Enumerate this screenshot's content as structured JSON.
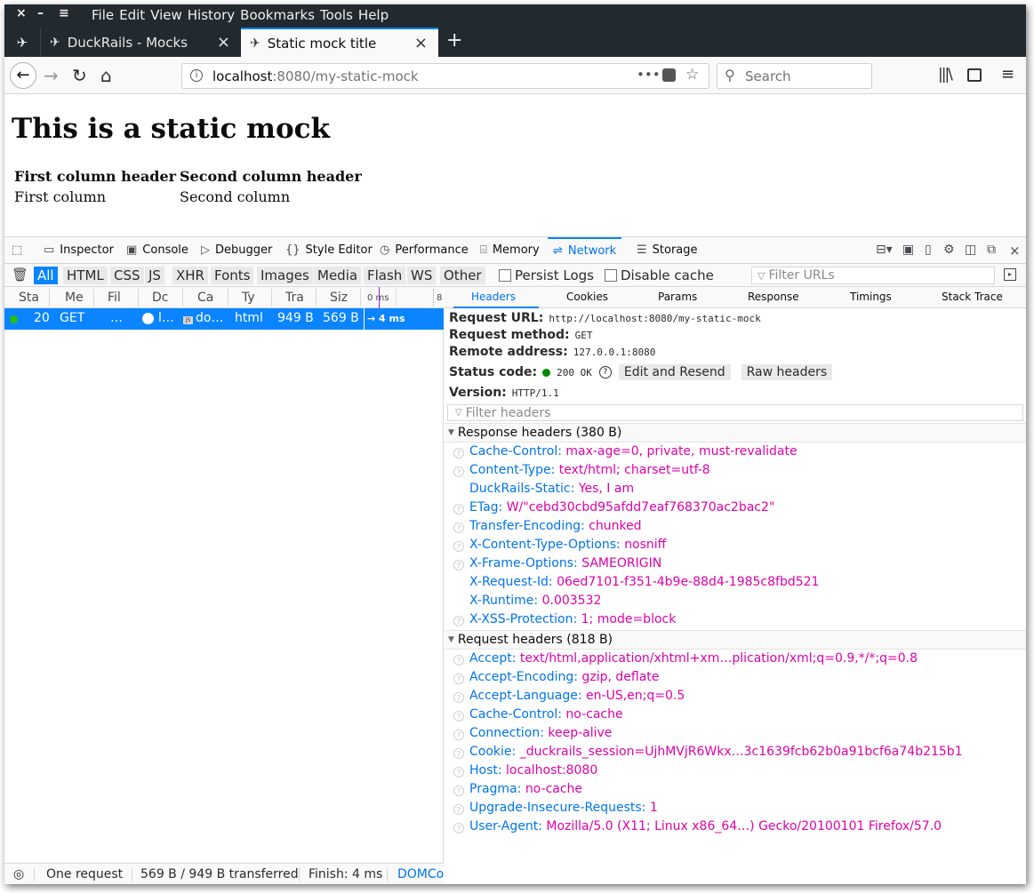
{
  "window": {
    "controls": {
      "close": "×",
      "minimize": "–",
      "menu": "≡"
    },
    "menu": [
      "File",
      "Edit",
      "View",
      "History",
      "Bookmarks",
      "Tools",
      "Help"
    ]
  },
  "tabs": [
    {
      "title": "DuckRails - Mocks",
      "active": false
    },
    {
      "title": "Static mock title",
      "active": true
    }
  ],
  "navbar": {
    "url_host": "localhost",
    "url_rest": ":8080/my-static-mock",
    "search_placeholder": "Search"
  },
  "page": {
    "heading": "This is a static mock",
    "table": {
      "headers": [
        "First column header",
        "Second column header"
      ],
      "row": [
        "First column",
        "Second column"
      ]
    }
  },
  "devtools": {
    "tools": [
      "Inspector",
      "Console",
      "Debugger",
      "Style Editor",
      "Performance",
      "Memory",
      "Network",
      "Storage"
    ],
    "active_tool": "Network",
    "type_filters": [
      "All",
      "HTML",
      "CSS",
      "JS",
      "XHR",
      "Fonts",
      "Images",
      "Media",
      "Flash",
      "WS",
      "Other"
    ],
    "persist_logs": "Persist Logs",
    "disable_cache": "Disable cache",
    "filter_urls_placeholder": "Filter URLs",
    "columns": [
      "Sta",
      "Me",
      "Fil",
      "Dc",
      "Ca",
      "Ty",
      "Tra",
      "Siz",
      "0 ms",
      "8"
    ],
    "request": {
      "status": "20",
      "method": "GET",
      "file": "…",
      "domain": "l…",
      "cause": "do…",
      "type": "html",
      "transferred": "949 B",
      "size": "569 B",
      "timing": "→ 4 ms"
    },
    "detail_tabs": [
      "Headers",
      "Cookies",
      "Params",
      "Response",
      "Timings",
      "Stack Trace"
    ],
    "summary": {
      "request_url_label": "Request URL:",
      "request_url": "http://localhost:8080/my-static-mock",
      "method_label": "Request method:",
      "method": "GET",
      "remote_label": "Remote address:",
      "remote": "127.0.0.1:8080",
      "status_label": "Status code:",
      "status": "200 OK",
      "edit_resend": "Edit and Resend",
      "raw_headers": "Raw headers",
      "version_label": "Version:",
      "version": "HTTP/1.1"
    },
    "filter_headers_placeholder": "Filter headers",
    "response_headers_title": "Response headers (380 B)",
    "response_headers": [
      {
        "k": "Cache-Control:",
        "v": "max-age=0, private, must-revalidate",
        "q": true
      },
      {
        "k": "Content-Type:",
        "v": "text/html; charset=utf-8",
        "q": true
      },
      {
        "k": "DuckRails-Static:",
        "v": "Yes, I am",
        "q": false
      },
      {
        "k": "ETag:",
        "v": "W/\"cebd30cbd95afdd7eaf768370ac2bac2\"",
        "q": true
      },
      {
        "k": "Transfer-Encoding:",
        "v": "chunked",
        "q": true
      },
      {
        "k": "X-Content-Type-Options:",
        "v": "nosniff",
        "q": true
      },
      {
        "k": "X-Frame-Options:",
        "v": "SAMEORIGIN",
        "q": true
      },
      {
        "k": "X-Request-Id:",
        "v": "06ed7101-f351-4b9e-88d4-1985c8fbd521",
        "q": false
      },
      {
        "k": "X-Runtime:",
        "v": "0.003532",
        "q": false
      },
      {
        "k": "X-XSS-Protection:",
        "v": "1; mode=block",
        "q": true
      }
    ],
    "request_headers_title": "Request headers (818 B)",
    "request_headers": [
      {
        "k": "Accept:",
        "v": "text/html,application/xhtml+xm…plication/xml;q=0.9,*/*;q=0.8",
        "q": true
      },
      {
        "k": "Accept-Encoding:",
        "v": "gzip, deflate",
        "q": true
      },
      {
        "k": "Accept-Language:",
        "v": "en-US,en;q=0.5",
        "q": true
      },
      {
        "k": "Cache-Control:",
        "v": "no-cache",
        "q": true
      },
      {
        "k": "Connection:",
        "v": "keep-alive",
        "q": true
      },
      {
        "k": "Cookie:",
        "v": "_duckrails_session=UjhMVjR6Wkx…3c1639fcb62b0a91bcf6a74b215b1",
        "q": true
      },
      {
        "k": "Host:",
        "v": "localhost:8080",
        "q": true
      },
      {
        "k": "Pragma:",
        "v": "no-cache",
        "q": true
      },
      {
        "k": "Upgrade-Insecure-Requests:",
        "v": "1",
        "q": true
      },
      {
        "k": "User-Agent:",
        "v": "Mozilla/5.0 (X11; Linux x86_64…) Gecko/20100101 Firefox/57.0",
        "q": true
      }
    ],
    "statusbar": {
      "requests": "One request",
      "transferred": "569 B / 949 B transferred",
      "finish": "Finish: 4 ms",
      "domcontent": "DOMCo"
    }
  }
}
